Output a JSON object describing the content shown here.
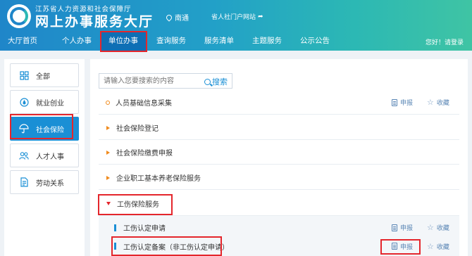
{
  "header": {
    "org_name": "江苏省人力资源和社会保障厅",
    "site_title": "网上办事服务大厅",
    "location": "南通",
    "portal_link": "省人社门户网站",
    "login_text": "您好！请登录"
  },
  "nav": {
    "items": [
      {
        "label": "大厅首页"
      },
      {
        "label": "个人办事"
      },
      {
        "label": "单位办事"
      },
      {
        "label": "查询服务"
      },
      {
        "label": "服务清单"
      },
      {
        "label": "主题服务"
      },
      {
        "label": "公示公告"
      }
    ],
    "active_index": 2
  },
  "sidebar": {
    "items": [
      {
        "label": "全部",
        "icon": "grid-icon"
      },
      {
        "label": "就业创业",
        "icon": "droplet-icon"
      },
      {
        "label": "社会保险",
        "icon": "umbrella-icon"
      },
      {
        "label": "人才人事",
        "icon": "people-icon"
      },
      {
        "label": "劳动关系",
        "icon": "document-icon"
      }
    ],
    "active_index": 2
  },
  "search": {
    "placeholder": "请输入您要搜索的内容",
    "button_label": "搜索"
  },
  "actions": {
    "apply": "申报",
    "favorite": "收藏"
  },
  "services": [
    {
      "label": "人员基础信息采集",
      "kind": "item"
    },
    {
      "label": "社会保险登记",
      "kind": "category"
    },
    {
      "label": "社会保险缴费申报",
      "kind": "category"
    },
    {
      "label": "企业职工基本养老保险服务",
      "kind": "category"
    },
    {
      "label": "工伤保险服务",
      "kind": "expanded"
    },
    {
      "label": "工伤认定申请",
      "kind": "sub"
    },
    {
      "label": "工伤认定备案（非工伤认定申请）",
      "kind": "sub"
    }
  ],
  "colors": {
    "primary": "#1a8fd5",
    "highlight": "#e4262c",
    "bullet": "#f08a1c"
  }
}
